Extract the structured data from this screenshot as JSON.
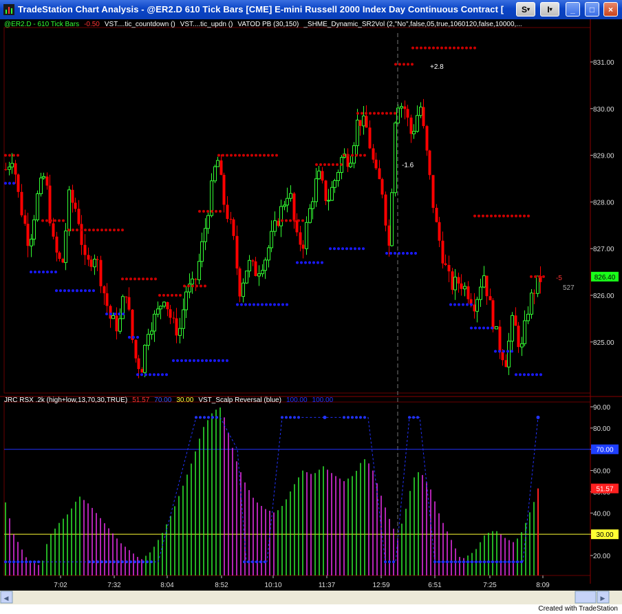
{
  "window": {
    "title": "TradeStation Chart Analysis - @ER2.D  610 Tick Bars [CME] E-mini Russell 2000 Index Day Continuous Contract [",
    "buttons": [
      "S",
      "I",
      "□",
      "×"
    ]
  },
  "price_panel": {
    "legend": [
      {
        "text": "@ER2.D - 610 Tick Bars",
        "color": "#33ff33"
      },
      {
        "text": "-0.50",
        "color": "#ff3333"
      },
      {
        "text": "VST....tic_countdown ()",
        "color": "#ffffff"
      },
      {
        "text": "VST....tic_updn ()",
        "color": "#ffffff"
      },
      {
        "text": "VATOD PB (30,150)",
        "color": "#ffffff"
      },
      {
        "text": "_SHME_Dynamic_SR2Vol (2,\"No\",false,05,true,1060120,false,10000,...",
        "color": "#ffffff"
      }
    ],
    "y_ticks": [
      "831.00",
      "830.00",
      "829.00",
      "828.00",
      "827.00",
      "826.00",
      "825.00"
    ],
    "last_price": "826.40",
    "annotations": [
      "+2.8",
      "-1.6",
      "-5",
      "527"
    ]
  },
  "indicator_panel": {
    "legend": [
      {
        "text": "JRC RSX .2k (high+low,13,70,30,TRUE)",
        "color": "#ffffff"
      },
      {
        "text": "51.57",
        "color": "#ff3333"
      },
      {
        "text": "70.00",
        "color": "#3355ff"
      },
      {
        "text": "30.00",
        "color": "#ffff33"
      },
      {
        "text": "VST_Scalp Reversal (blue)",
        "color": "#ffffff"
      },
      {
        "text": "100.00",
        "color": "#2233ff"
      },
      {
        "text": "100.00",
        "color": "#2233ff"
      }
    ],
    "y_ticks": [
      "90.00",
      "80.00",
      "70.00",
      "60.00",
      "50.00",
      "40.00",
      "30.00",
      "20.00"
    ],
    "badges": [
      {
        "text": "70.00",
        "bg": "#1f3fff",
        "fg": "#ffffff",
        "level": 70
      },
      {
        "text": "51.57",
        "bg": "#ff2020",
        "fg": "#ffffff",
        "level": 51.57
      },
      {
        "text": "30.00",
        "bg": "#ffff33",
        "fg": "#000000",
        "level": 30
      }
    ]
  },
  "x_axis": {
    "ticks": [
      "7:02",
      "7:32",
      "8:04",
      "8:52",
      "10:10",
      "11:37",
      "12:59",
      "6:51",
      "7:25",
      "8:09"
    ]
  },
  "footer": {
    "credit": "Created with TradeStation"
  },
  "colors": {
    "up": "#33ff33",
    "down": "#ff0000",
    "resistance": "#cc0000",
    "support": "#1a1aff",
    "magenta": "#ff33ff"
  }
}
